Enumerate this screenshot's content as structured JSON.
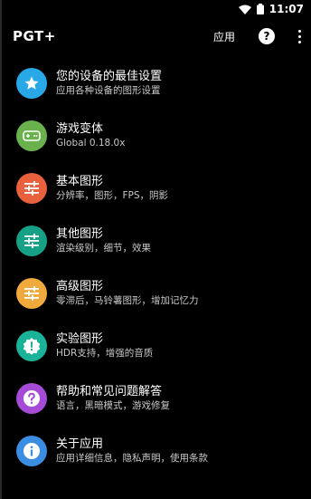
{
  "status_bar": {
    "time": "11:07"
  },
  "app_bar": {
    "title": "PGT+",
    "apps_label": "应用",
    "help_glyph": "?"
  },
  "menu": [
    {
      "title": "您的设备的最佳设置",
      "subtitle": "应用各种设备的图形设置",
      "icon": "star-icon",
      "color": "#29a8e8"
    },
    {
      "title": "游戏变体",
      "subtitle": "Global 0.18.0x",
      "icon": "gamepad-icon",
      "color": "#6ab04c"
    },
    {
      "title": "基本图形",
      "subtitle": "分辨率，图形，FPS，阴影",
      "icon": "sliders-icon",
      "color": "#e8603c"
    },
    {
      "title": "其他图形",
      "subtitle": "渲染级别，细节，效果",
      "icon": "sliders-icon",
      "color": "#16a085"
    },
    {
      "title": "高级图形",
      "subtitle": "零滞后，马铃薯图形，增加记忆力",
      "icon": "sliders-icon",
      "color": "#f0a93c"
    },
    {
      "title": "实验图形",
      "subtitle": "HDR支持，增强的音质",
      "icon": "alert-badge-icon",
      "color": "#1ab39a"
    },
    {
      "title": "帮助和常见问题解答",
      "subtitle": "语言，黑暗模式，游戏修复",
      "icon": "question-icon",
      "color": "#a64bd6"
    },
    {
      "title": "关于应用",
      "subtitle": "应用详细信息，隐私声明，使用条款",
      "icon": "info-icon",
      "color": "#3a8de0"
    }
  ]
}
